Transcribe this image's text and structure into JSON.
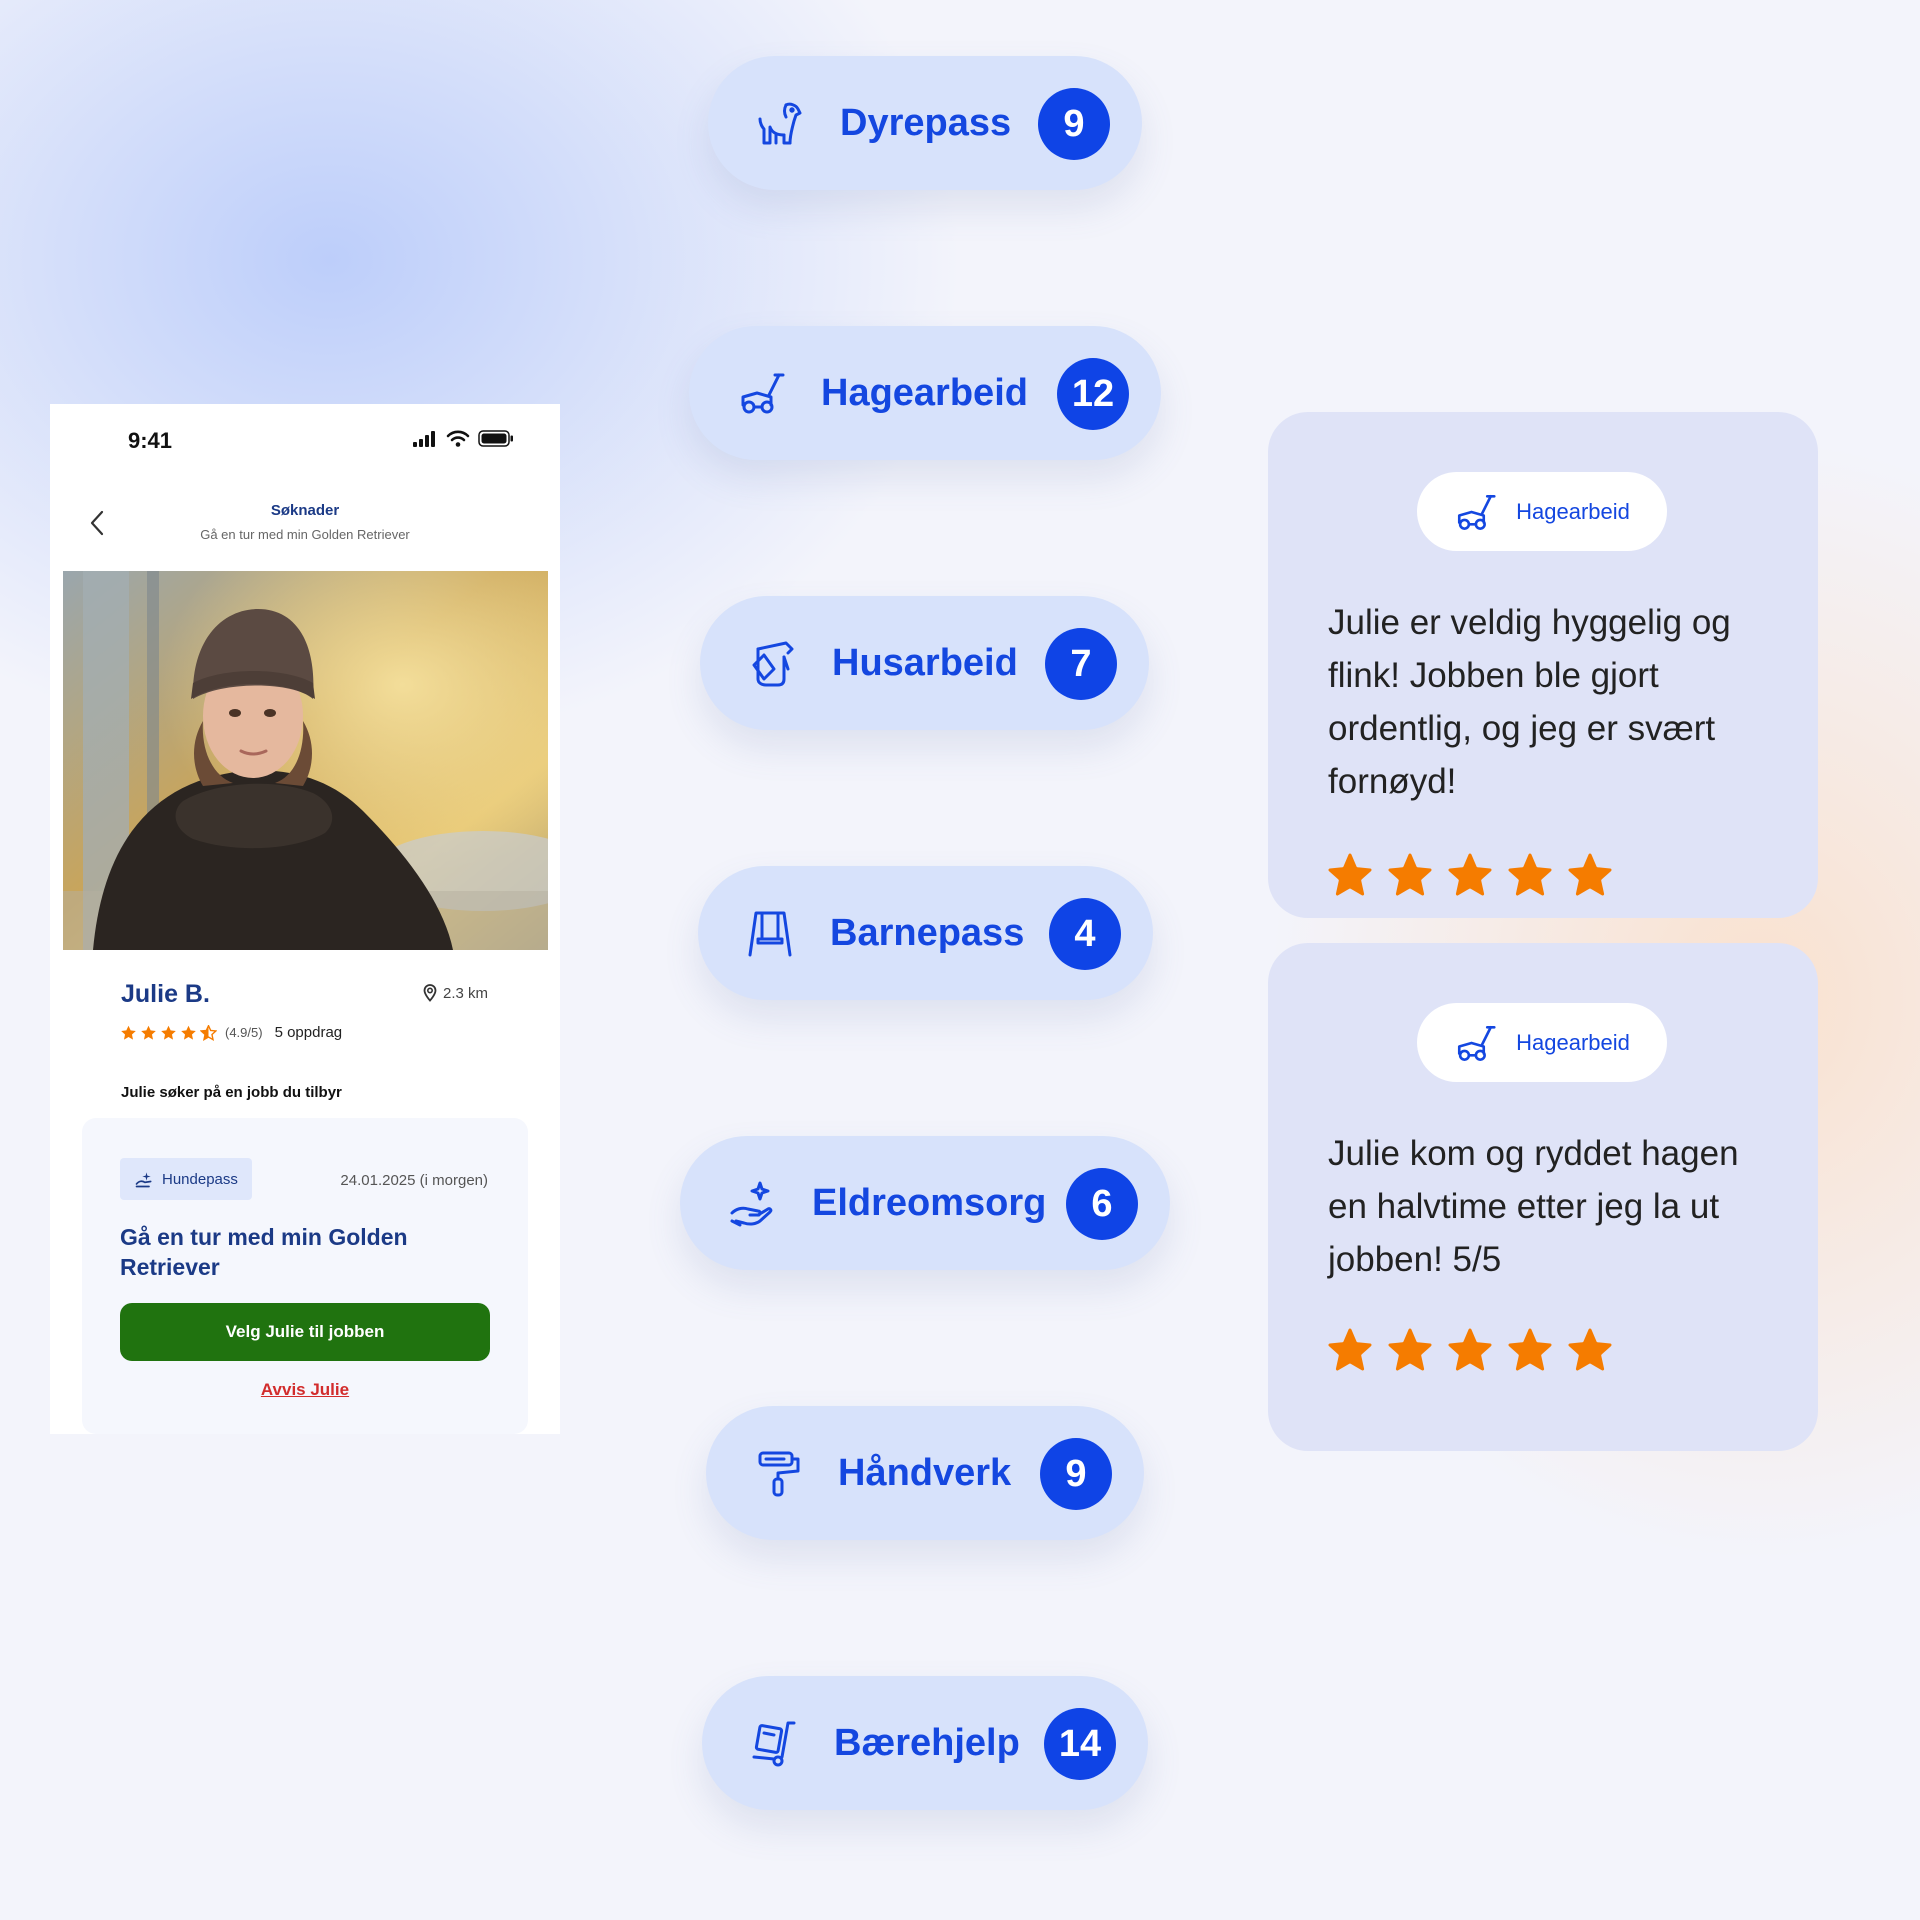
{
  "phone": {
    "status_time": "9:41",
    "nav_title": "Søknader",
    "nav_subtitle": "Gå en tur med min Golden Retriever",
    "profile": {
      "name": "Julie B.",
      "distance": "2.3 km",
      "rating_text": "(4.9/5)",
      "rating": 4.5,
      "jobs_count": "5 oppdrag"
    },
    "apply_text": "Julie søker på en jobb du tilbyr",
    "job": {
      "category": "Hundepass",
      "date": "24.01.2025 (i morgen)",
      "title": "Gå en tur med min Golden Retriever",
      "choose_button": "Velg Julie til jobben",
      "reject_link": "Avvis Julie"
    }
  },
  "categories": [
    {
      "label": "Dyrepass",
      "count": "9",
      "icon": "dog-icon"
    },
    {
      "label": "Hagearbeid",
      "count": "12",
      "icon": "lawnmower-icon"
    },
    {
      "label": "Husarbeid",
      "count": "7",
      "icon": "cleaning-icon"
    },
    {
      "label": "Barnepass",
      "count": "4",
      "icon": "swing-icon"
    },
    {
      "label": "Eldreomsorg",
      "count": "6",
      "icon": "care-hand-icon"
    },
    {
      "label": "Håndverk",
      "count": "9",
      "icon": "paint-roller-icon"
    },
    {
      "label": "Bærehjelp",
      "count": "14",
      "icon": "hand-truck-icon"
    }
  ],
  "reviews": [
    {
      "category": "Hagearbeid",
      "text": "Julie er veldig hyggelig og flink! Jobben ble gjort ordentlig, og jeg er svært fornøyd!",
      "stars": 5
    },
    {
      "category": "Hagearbeid",
      "text": "Julie kom og ryddet hagen en halvtime etter jeg la ut jobben! 5/5",
      "stars": 5
    }
  ],
  "colors": {
    "brand_blue": "#0f44e6",
    "pill_bg": "#d7e2fb",
    "star_orange": "#f57c00",
    "choose_green": "#20730f",
    "reject_red": "#d22c2c"
  }
}
